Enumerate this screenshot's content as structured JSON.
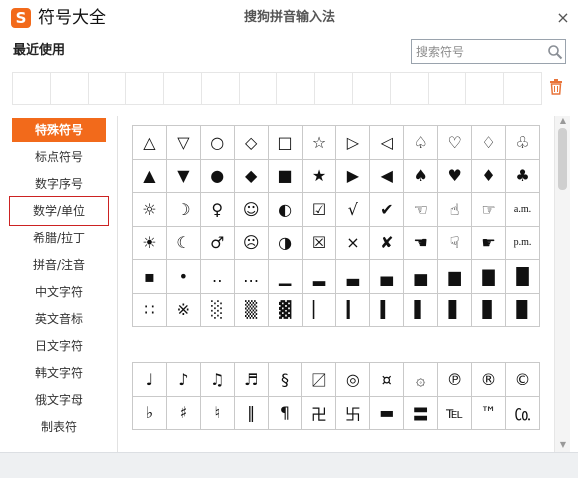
{
  "window": {
    "title": "符号大全",
    "center_title": "搜狗拼音输入法",
    "logo_letter": "S",
    "close_symbol": "×"
  },
  "recent": {
    "label": "最近使用",
    "cell_count": 14
  },
  "search": {
    "placeholder": "搜索符号",
    "value": ""
  },
  "sidebar": {
    "items": [
      {
        "label": "特殊符号",
        "active": true
      },
      {
        "label": "标点符号"
      },
      {
        "label": "数字序号"
      },
      {
        "label": "数学/单位",
        "boxed": true
      },
      {
        "label": "希腊/拉丁"
      },
      {
        "label": "拼音/注音"
      },
      {
        "label": "中文字符"
      },
      {
        "label": "英文音标"
      },
      {
        "label": "日文字符"
      },
      {
        "label": "韩文字符"
      },
      {
        "label": "俄文字母"
      },
      {
        "label": "制表符"
      }
    ]
  },
  "grid_top": [
    [
      "△",
      "▽",
      "○",
      "◇",
      "□",
      "☆",
      "▷",
      "◁",
      "♤",
      "♡",
      "♢",
      "♧"
    ],
    [
      "▲",
      "▼",
      "●",
      "◆",
      "■",
      "★",
      "▶",
      "◀",
      "♠",
      "♥",
      "♦",
      "♣"
    ],
    [
      "☼",
      "☽",
      "♀",
      "☺",
      "◐",
      "☑",
      "√",
      "✔",
      "☜",
      "☝",
      "☞",
      "a.m."
    ],
    [
      "☀",
      "☾",
      "♂",
      "☹",
      "◑",
      "☒",
      "×",
      "✘",
      "☚",
      "☟",
      "☛",
      "p.m."
    ],
    [
      "▪",
      "•",
      "‥",
      "…",
      "▁",
      "▂",
      "▃",
      "▄",
      "▅",
      "▆",
      "▇",
      "█"
    ],
    [
      "∷",
      "※",
      "░",
      "▒",
      "▓",
      "▏",
      "▎",
      "▍",
      "▌",
      "▋",
      "▊",
      "▉"
    ]
  ],
  "grid_bottom": [
    [
      "♩",
      "♪",
      "♫",
      "♬",
      "§",
      "〼",
      "◎",
      "¤",
      "۞",
      "℗",
      "®",
      "©"
    ],
    [
      "♭",
      "♯",
      "♮",
      "‖",
      "¶",
      "卍",
      "卐",
      "▬",
      "〓",
      "℡",
      "™",
      "㏇"
    ]
  ],
  "colors": {
    "accent": "#f26a1b",
    "highlight_box": "#cc2222",
    "grid_border": "#c9c9c9"
  }
}
